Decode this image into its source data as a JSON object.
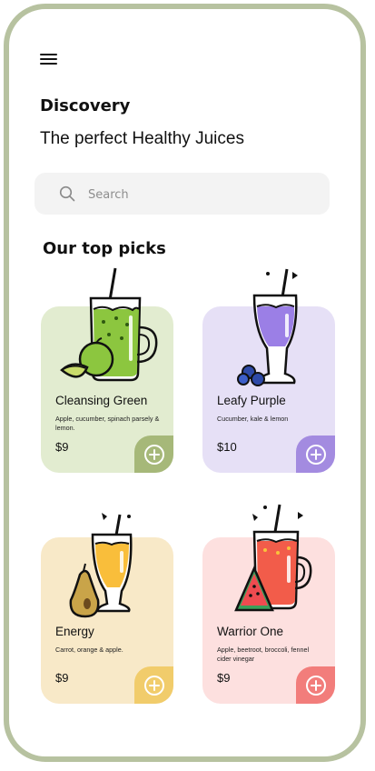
{
  "header": {
    "title": "Discovery",
    "subtitle": "The perfect Healthy Juices"
  },
  "search": {
    "placeholder": "Search"
  },
  "section": {
    "title": "Our top picks"
  },
  "products": [
    {
      "name": "Cleansing Green",
      "description": "Apple, cucumber, spinach parsely & lemon.",
      "price": "$9",
      "bg": "#e2ecd0",
      "accent": "#a6b879"
    },
    {
      "name": "Leafy Purple",
      "description": "Cucumber, kale & lemon",
      "price": "$10",
      "bg": "#e6e0f6",
      "accent": "#a38be0"
    },
    {
      "name": "Energy",
      "description": "Carrot, orange & apple.",
      "price": "$9",
      "bg": "#f8e9c8",
      "accent": "#f1cc6b"
    },
    {
      "name": "Warrior One",
      "description": "Apple, beetroot, broccoli, fennel cider vinegar",
      "price": "$9",
      "bg": "#fde0df",
      "accent": "#f27d7b"
    }
  ]
}
